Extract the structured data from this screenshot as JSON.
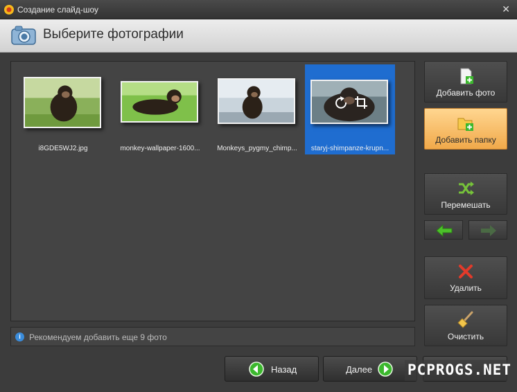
{
  "window": {
    "title": "Создание слайд-шоу",
    "close_glyph": "✕"
  },
  "header": {
    "title": "Выберите фотографии",
    "icon": "camera-icon"
  },
  "photos": [
    {
      "filename": "i8GDE5WJ2.jpg",
      "selected": false
    },
    {
      "filename": "monkey-wallpaper-1600...",
      "selected": false
    },
    {
      "filename": "Monkeys_pygmy_chimp...",
      "selected": false
    },
    {
      "filename": "staryj-shimpanze-krupn...",
      "selected": true
    }
  ],
  "info": {
    "icon": "info-icon",
    "glyph": "i",
    "text": "Рекомендуем добавить еще 9 фото"
  },
  "side_buttons": {
    "add_photo": "Добавить фото",
    "add_folder": "Добавить папку",
    "shuffle": "Перемешать",
    "delete": "Удалить",
    "clear": "Очистить"
  },
  "nav": {
    "back": "Назад",
    "next": "Далее"
  },
  "watermark": "PCPROGS.NET",
  "colors": {
    "selection": "#1f6dd0",
    "highlight": "#f1a94a",
    "green": "#3cb82e"
  }
}
